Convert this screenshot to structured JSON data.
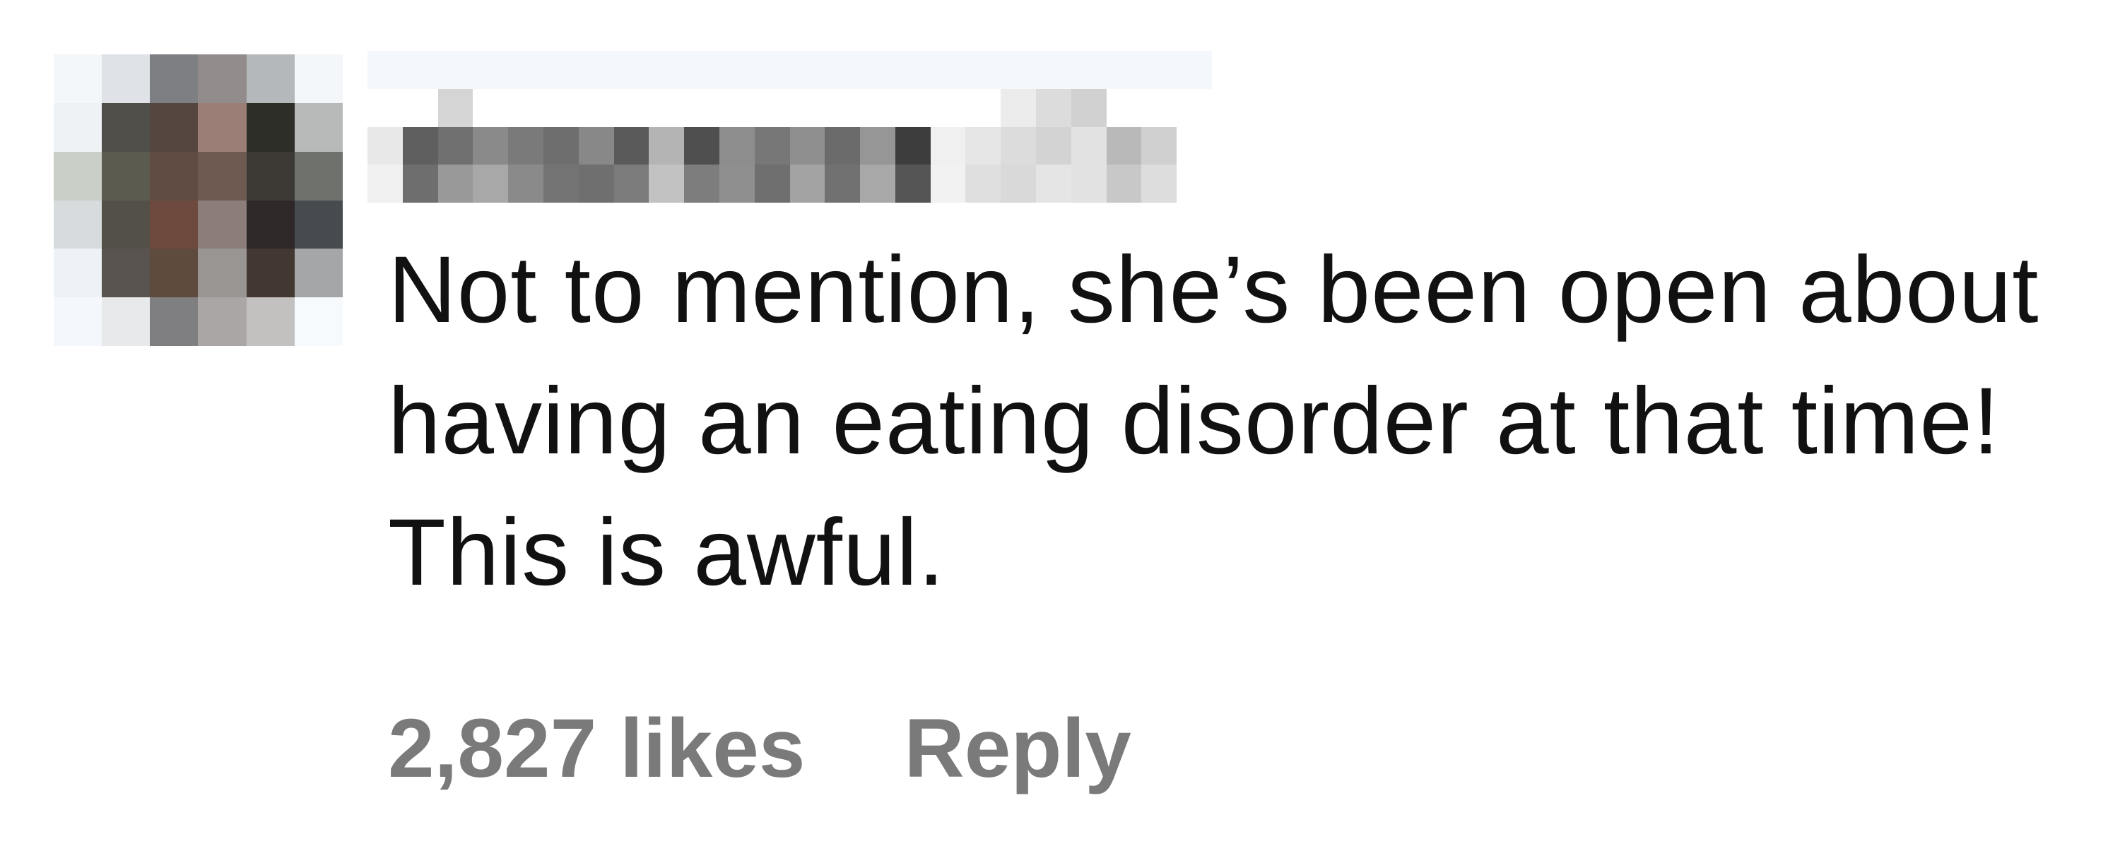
{
  "comment": {
    "text": "Not to mention, she’s been open about having an eating disorder at that time! This is awful.",
    "likes_label": "2,827 likes",
    "reply_label": "Reply"
  },
  "avatar": {
    "icon": "pixelated-profile-photo",
    "pixels": [
      "#f4f7fa",
      "#dfe3e8",
      "#7d7f83",
      "#918c8b",
      "#b5b8bb",
      "#f4f7fa",
      "#eef2f4",
      "#4f4e48",
      "#55463f",
      "#9b7f76",
      "#2e2e29",
      "#b8b9b9",
      "#c9cec6",
      "#5c5b50",
      "#604c43",
      "#6f5a52",
      "#3d3a36",
      "#6f716d",
      "#d7dbdd",
      "#535048",
      "#6d4a3d",
      "#8c7d7a",
      "#2f2828",
      "#474b50",
      "#eef2f6",
      "#59544f",
      "#5f4a3e",
      "#999593",
      "#433731",
      "#a4a6a8",
      "#f4f7fb",
      "#e7e9eb",
      "#7f7f81",
      "#aaa6a5",
      "#c2c1c0",
      "#f7fafc"
    ]
  },
  "username": {
    "icon": "pixelated-username",
    "pixels": [
      "#f4f8fc",
      "#f4f8fc",
      "#f4f8fc",
      "#f4f8fc",
      "#f4f8fc",
      "#f4f8fc",
      "#f4f8fc",
      "#f4f8fc",
      "#f4f8fc",
      "#f4f8fc",
      "#f4f8fc",
      "#f4f8fc",
      "#f4f8fc",
      "#f4f8fc",
      "#f4f8fc",
      "#f4f8fc",
      "#f4f8fc",
      "#f4f8fc",
      "#f4f8fc",
      "#f4f8fc",
      "#f4f8fc",
      "#f4f8fc",
      "#f4f8fc",
      "#f4f8fc",
      "#ffffff",
      "#ffffff",
      "#d5d5d5",
      "#ffffff",
      "#ffffff",
      "#ffffff",
      "#ffffff",
      "#ffffff",
      "#ffffff",
      "#ffffff",
      "#ffffff",
      "#ffffff",
      "#ffffff",
      "#ffffff",
      "#ffffff",
      "#ffffff",
      "#ffffff",
      "#ffffff",
      "#ececec",
      "#dcdcdc",
      "#d1d1d1",
      "#ffffff",
      "#ffffff",
      "#ffffff",
      "#e8e8e8",
      "#5f5f5f",
      "#707070",
      "#8a8a8a",
      "#7a7a7a",
      "#6e6e6e",
      "#888888",
      "#5a5a5a",
      "#b4b4b4",
      "#4f4f4f",
      "#8d8d8d",
      "#777777",
      "#8f8f8f",
      "#6b6b6b",
      "#969696",
      "#3d3d3d",
      "#f0f0f0",
      "#e6e6e6",
      "#dcdcdc",
      "#d3d3d3",
      "#e2e2e2",
      "#b9b9b9",
      "#d0d0d0",
      "#ffffff",
      "#f0f0f0",
      "#6e6e6e",
      "#999999",
      "#a8a8a8",
      "#8a8a8a",
      "#747474",
      "#6f6f6f",
      "#7b7b7b",
      "#c2c2c2",
      "#7d7d7d",
      "#8f8f8f",
      "#6f6f6f",
      "#a3a3a3",
      "#717171",
      "#a8a8a8",
      "#555555",
      "#f2f2f2",
      "#dfdfdf",
      "#d9d9d9",
      "#e5e5e5",
      "#e2e2e2",
      "#c8c8c8",
      "#dddddd",
      "#ffffff"
    ]
  }
}
